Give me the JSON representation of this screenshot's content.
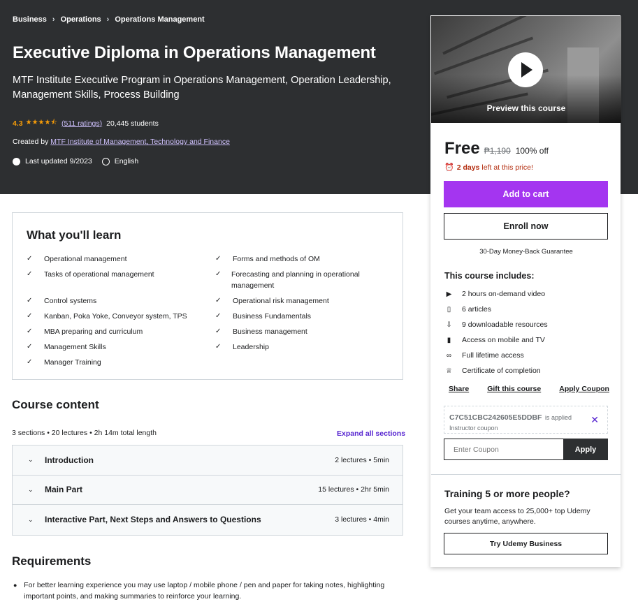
{
  "breadcrumb": [
    "Business",
    "Operations",
    "Operations Management"
  ],
  "course": {
    "title": "Executive Diploma in Operations Management",
    "subtitle": "MTF Institute Executive Program in Operations Management, Operation Leadership, Management Skills, Process Building",
    "rating": "4.3",
    "ratings_count": "(511 ratings)",
    "students": "20,445 students",
    "created_by_label": "Created by",
    "instructor": "MTF Institute of Management, Technology and Finance",
    "last_updated": "Last updated 9/2023",
    "language": "English"
  },
  "learn": {
    "heading": "What you'll learn",
    "left": [
      "Operational management",
      "Tasks of operational management",
      "Control systems",
      "Kanban, Poka Yoke, Conveyor system, TPS",
      "MBA preparing and curriculum",
      "Management Skills",
      "Manager Training"
    ],
    "right": [
      "Forms and methods of OM",
      "Forecasting and planning in operational management",
      "Operational risk management",
      "Business Fundamentals",
      "Business management",
      "Leadership"
    ]
  },
  "content": {
    "heading": "Course content",
    "summary": "3 sections • 20 lectures • 2h 14m total length",
    "expand_label": "Expand all sections",
    "sections": [
      {
        "title": "Introduction",
        "info": "2 lectures • 5min"
      },
      {
        "title": "Main Part",
        "info": "15 lectures • 2hr 5min"
      },
      {
        "title": "Interactive Part, Next Steps and Answers to Questions",
        "info": "3 lectures • 4min"
      }
    ]
  },
  "requirements": {
    "heading": "Requirements",
    "items": [
      "For better learning experience you may use laptop / mobile phone / pen and paper for taking notes, highlighting important points, and making summaries to reinforce your learning."
    ]
  },
  "sidebar": {
    "preview_label": "Preview this course",
    "price_now": "Free",
    "price_old": "₱1,190",
    "discount": "100% off",
    "urgency_bold": "2 days",
    "urgency_rest": "left at this price!",
    "add_to_cart": "Add to cart",
    "enroll": "Enroll now",
    "guarantee": "30-Day Money-Back Guarantee",
    "includes_heading": "This course includes:",
    "includes": [
      {
        "icon": "video-icon",
        "label": "2 hours on-demand video"
      },
      {
        "icon": "article-icon",
        "label": "6 articles"
      },
      {
        "icon": "download-icon",
        "label": "9 downloadable resources"
      },
      {
        "icon": "mobile-icon",
        "label": "Access on mobile and TV"
      },
      {
        "icon": "infinity-icon",
        "label": "Full lifetime access"
      },
      {
        "icon": "trophy-icon",
        "label": "Certificate of completion"
      }
    ],
    "share": "Share",
    "gift": "Gift this course",
    "apply_coupon": "Apply Coupon",
    "coupon_code": "C7C51CBC242605E5DDBF",
    "coupon_applied": "is applied",
    "coupon_source": "Instructor coupon",
    "coupon_placeholder": "Enter Coupon",
    "apply_button": "Apply",
    "training_heading": "Training 5 or more people?",
    "training_text": "Get your team access to 25,000+ top Udemy courses anytime, anywhere.",
    "business_button": "Try Udemy Business"
  },
  "colors": {
    "hero_bg": "#2d2f31",
    "accent_purple": "#a435f0",
    "link_purple": "#5624d0",
    "star_orange": "#f69c08",
    "urgency_red": "#b32d0f"
  }
}
